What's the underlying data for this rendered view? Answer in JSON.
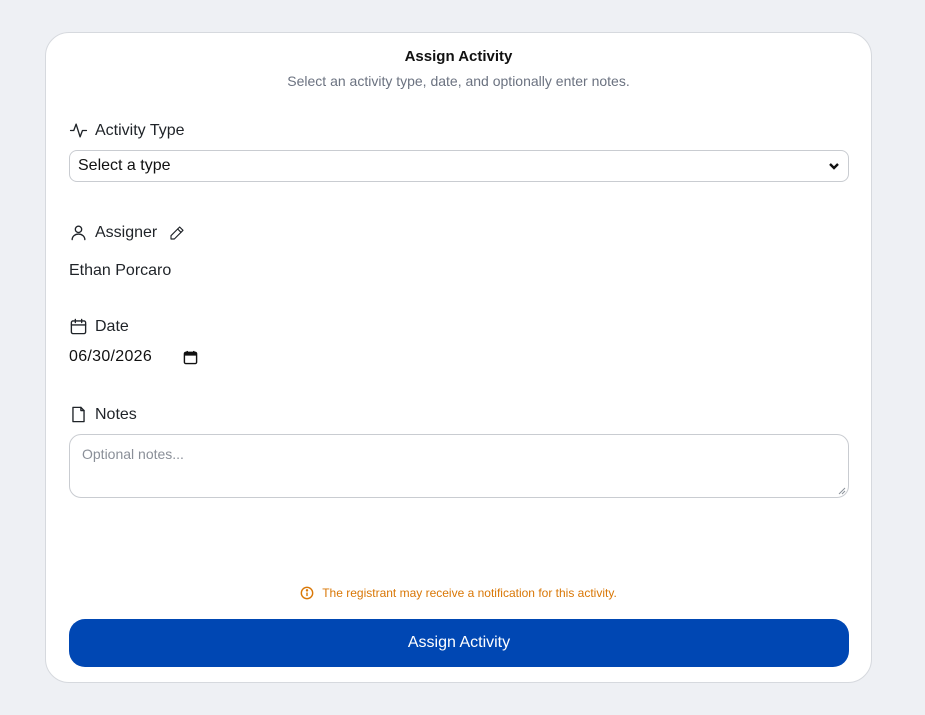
{
  "dialog": {
    "title": "Assign Activity",
    "subtitle": "Select an activity type, date, and optionally enter notes."
  },
  "activity_type": {
    "label": "Activity Type",
    "selected": "Select a type"
  },
  "assigner": {
    "label": "Assigner",
    "name": "Ethan Porcaro"
  },
  "date": {
    "label": "Date",
    "value": "06/30/2026"
  },
  "notes": {
    "label": "Notes",
    "placeholder": "Optional notes..."
  },
  "notice": {
    "text": "The registrant may receive a notification for this activity.",
    "color": "#d97706"
  },
  "submit": {
    "label": "Assign Activity",
    "color": "#0047b3"
  },
  "icons": {
    "activity_type": "activity-pulse-icon",
    "assigner": "user-icon",
    "edit": "pencil-icon",
    "date": "calendar-icon",
    "notes": "file-icon",
    "notice": "info-icon"
  }
}
